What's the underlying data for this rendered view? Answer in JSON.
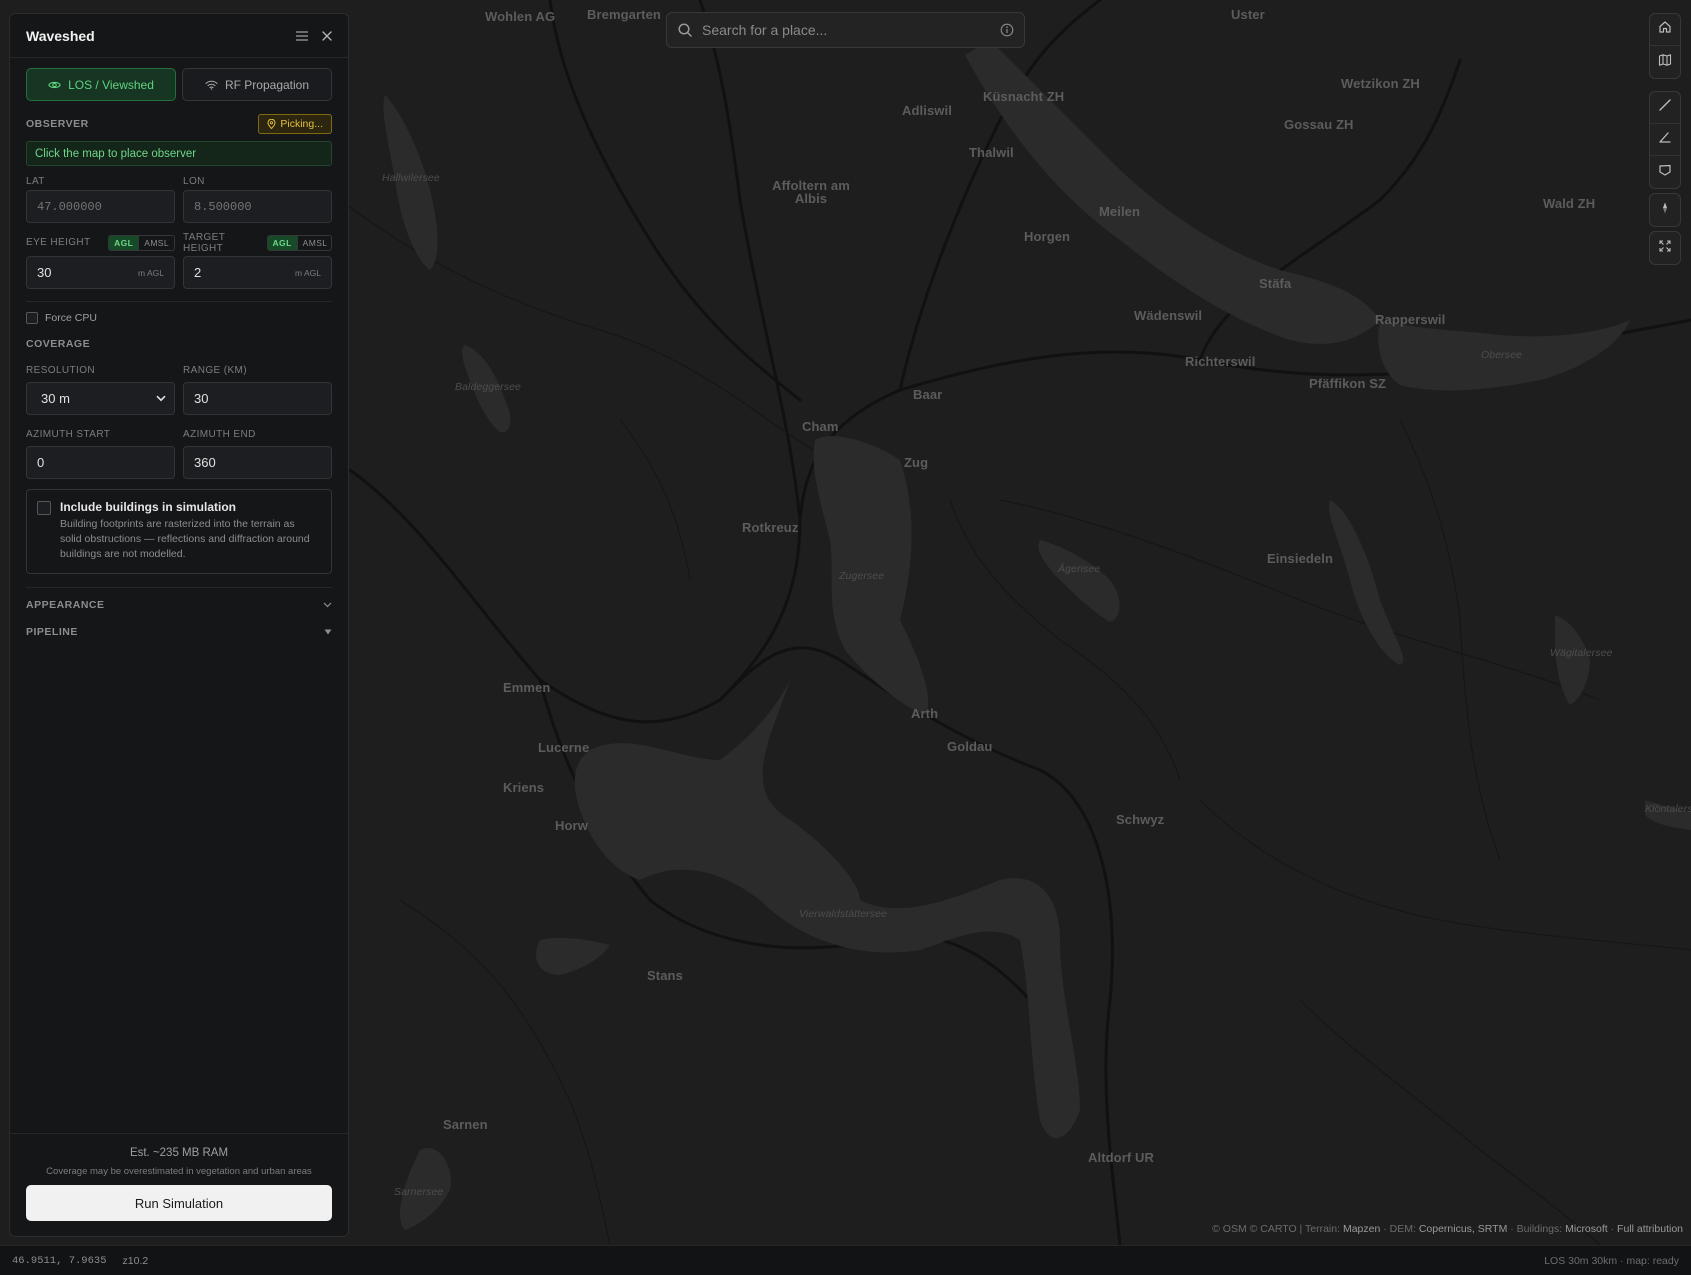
{
  "app": {
    "title": "Waveshed"
  },
  "search": {
    "placeholder": "Search for a place..."
  },
  "modes": [
    {
      "label": "LOS / Viewshed",
      "icon": "eye-icon",
      "active": true
    },
    {
      "label": "RF Propagation",
      "icon": "wifi-icon",
      "active": false
    }
  ],
  "observer": {
    "section": "OBSERVER",
    "picking_label": "Picking...",
    "hint": "Click the map to place observer",
    "lat_label": "LAT",
    "lat_placeholder": "47.000000",
    "lon_label": "LON",
    "lon_placeholder": "8.500000",
    "eye_height_label": "EYE HEIGHT",
    "eye_height_value": "30",
    "target_height_label": "TARGET HEIGHT",
    "target_height_value": "2",
    "agl": "AGL",
    "amsl": "AMSL",
    "unit": "m AGL"
  },
  "force_cpu_label": "Force CPU",
  "coverage": {
    "section": "COVERAGE",
    "resolution_label": "RESOLUTION",
    "resolution_value": "30 m",
    "range_label": "RANGE (KM)",
    "range_value": "30",
    "az_start_label": "AZIMUTH START",
    "az_start_value": "0",
    "az_end_label": "AZIMUTH END",
    "az_end_value": "360"
  },
  "buildings": {
    "title": "Include buildings in simulation",
    "description": "Building footprints are rasterized into the terrain as solid obstructions — reflections and diffraction around buildings are not modelled."
  },
  "sections": {
    "appearance": "APPEARANCE",
    "pipeline": "PIPELINE"
  },
  "footer": {
    "estimate": "Est. ~235 MB RAM",
    "warning": "Coverage may be overestimated in vegetation and urban areas",
    "run_label": "Run Simulation"
  },
  "status": {
    "coords": "46.9511, 7.9635",
    "zoom": "z10.2",
    "summary": "LOS 30m 30km · map: ready"
  },
  "attribution": {
    "prefix": "© OSM © CARTO | Terrain: ",
    "terrain": "Mapzen",
    "dem_prefix": " · DEM: ",
    "dem": "Copernicus, SRTM",
    "buildings_prefix": " · Buildings: ",
    "buildings": "Microsoft",
    "full": "Full attribution"
  },
  "map_labels": {
    "towns": [
      "Wohlen AG",
      "Bremgarten",
      "Uster",
      "Wetzikon ZH",
      "Adliswil",
      "Küsnacht ZH",
      "Gossau ZH",
      "Thalwil",
      "Affoltern am Albis",
      "Meilen",
      "Wald ZH",
      "Horgen",
      "Stäfa",
      "Wädenswil",
      "Rapperswil",
      "Richterswil",
      "Pfäffikon SZ",
      "Baar",
      "Cham",
      "Zug",
      "Rotkreuz",
      "Einsiedeln",
      "Emmen",
      "Arth",
      "Lucerne",
      "Goldau",
      "Kriens",
      "Horw",
      "Schwyz",
      "Stans",
      "Sarnen",
      "Altdorf UR"
    ],
    "lakes": [
      "Hallwilersee",
      "Baldeggersee",
      "Obersee",
      "Zugersee",
      "Ägerisee",
      "Wägitalersee",
      "Klöntalersee",
      "Vierwaldstättersee",
      "Sarnersee"
    ]
  },
  "colors": {
    "accent": "#5fd37f",
    "picking": "#e3c13a",
    "map_bg": "#1e1e1e",
    "water": "#2b2b2b"
  }
}
